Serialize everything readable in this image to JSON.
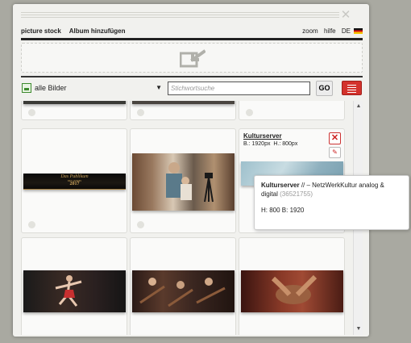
{
  "menubar": {
    "items": [
      "picture stock",
      "Album hinzufügen"
    ],
    "right": {
      "zoom": "zoom",
      "help": "hilfe",
      "lang": "DE"
    }
  },
  "toolbar": {
    "album": "alle Bilder",
    "search_placeholder": "Stichwortsuche",
    "go_label": "GO"
  },
  "cards": [
    {
      "title": "Kulturserver",
      "width_label": "B.: 1920px",
      "height_label": "H.: 800px"
    }
  ],
  "banner": {
    "line1": "Das Publikum",
    "line2": "DES JAHRES",
    "year": "2017"
  },
  "tooltip": {
    "title": "Kulturserver",
    "subtitle": "// – NetzWerkKultur analog & digital",
    "id": "(36521755)",
    "size": "H: 800  B: 1920"
  },
  "colors": {
    "accent": "#d3322c",
    "background": "#a9a9a1",
    "dialog": "#f1f1ee"
  }
}
